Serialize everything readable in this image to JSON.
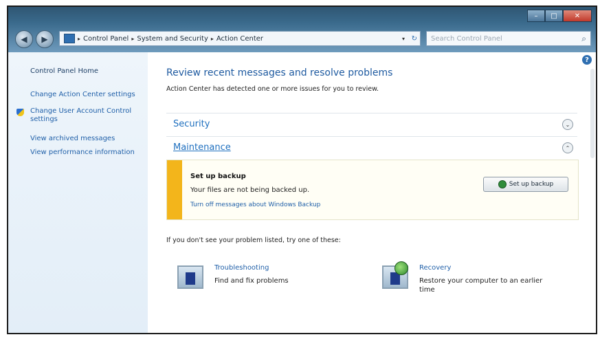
{
  "window": {
    "caption_min": "–",
    "caption_max": "□",
    "caption_close": "✕"
  },
  "nav": {
    "back_glyph": "◀",
    "forward_glyph": "▶",
    "breadcrumb": [
      "Control Panel",
      "System and Security",
      "Action Center"
    ],
    "crumb_separator": "▸",
    "dropdown_glyph": "▾",
    "refresh_glyph": "↻"
  },
  "search": {
    "placeholder": "Search Control Panel",
    "icon": "search-icon"
  },
  "sidebar": {
    "home": "Control Panel Home",
    "links": [
      "Change Action Center settings",
      "Change User Account Control settings",
      "View archived messages",
      "View performance information"
    ]
  },
  "main": {
    "help_glyph": "?",
    "title": "Review recent messages and resolve problems",
    "subtitle": "Action Center has detected one or more issues for you to review.",
    "sections": [
      {
        "label": "Security",
        "expand_glyph": "⌄"
      },
      {
        "label": "Maintenance",
        "expand_glyph": "⌃"
      }
    ],
    "backup": {
      "title": "Set up backup",
      "description": "Your files are not being backed up.",
      "link": "Turn off messages about Windows Backup",
      "button": "Set up backup",
      "accent_color": "#f3b51b"
    },
    "hint": "If you don't see your problem listed, try one of these:",
    "tools": [
      {
        "title": "Troubleshooting",
        "description": "Find and fix problems"
      },
      {
        "title": "Recovery",
        "description": "Restore your computer to an earlier time"
      }
    ]
  }
}
